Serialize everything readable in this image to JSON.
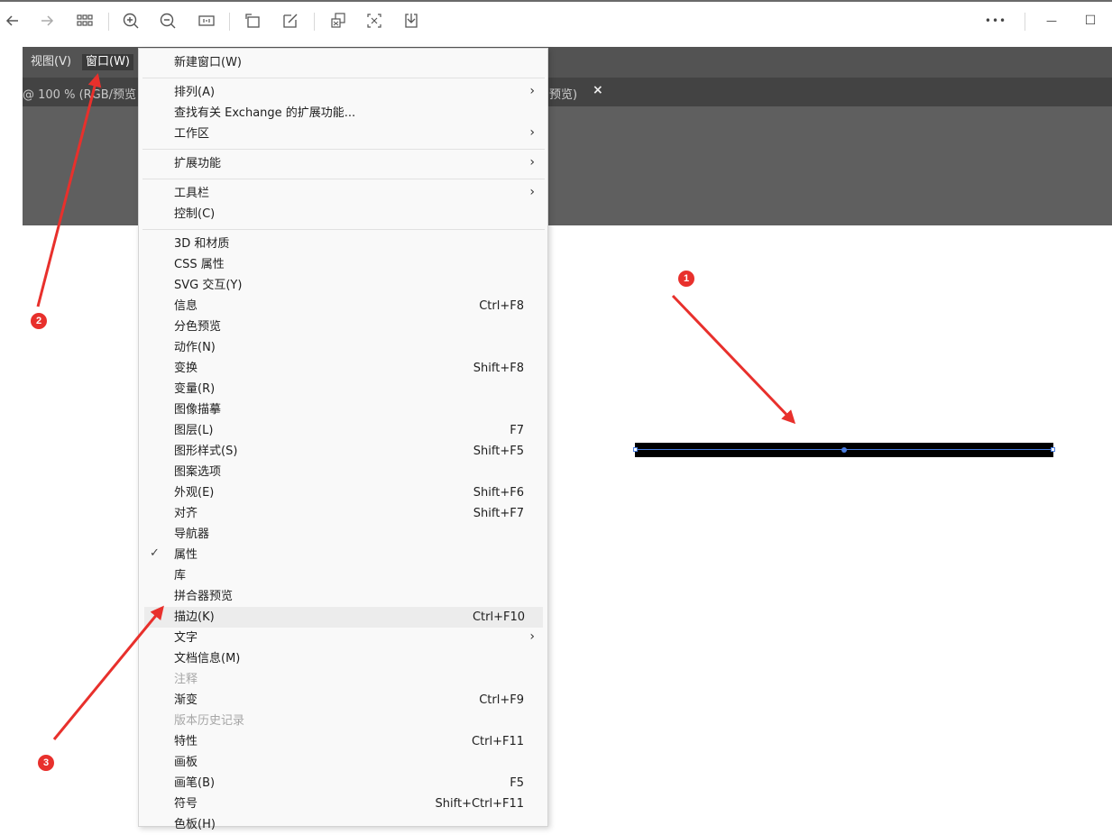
{
  "viewer_toolbar": {
    "icons": [
      "back-arrow-icon",
      "forward-arrow-icon",
      "grid-icon",
      "zoom-in-icon",
      "zoom-out-icon",
      "fit-page-icon",
      "rotate-icon",
      "edit-icon",
      "extract-text-icon",
      "ocr-icon",
      "download-icon",
      "more-icon",
      "minimize-icon",
      "maximize-icon"
    ],
    "more_label": "•••",
    "minimize_label": "—",
    "maximize_label": "☐"
  },
  "app_menubar": {
    "view_label": "视图(V)",
    "window_label": "窗口(W)"
  },
  "doc_tabs": {
    "left_text": "@ 100 % (RGB/预览",
    "right_text": "预览)",
    "close_label": "×"
  },
  "window_menu": {
    "items": [
      {
        "label": "新建窗口(W)",
        "shortcut": "",
        "arrow": false,
        "checked": false,
        "disabled": false
      },
      {
        "label": "排列(A)",
        "shortcut": "",
        "arrow": true,
        "checked": false,
        "disabled": false
      },
      {
        "label": "查找有关 Exchange 的扩展功能...",
        "shortcut": "",
        "arrow": false,
        "checked": false,
        "disabled": false
      },
      {
        "label": "工作区",
        "shortcut": "",
        "arrow": true,
        "checked": false,
        "disabled": false
      },
      {
        "label": "扩展功能",
        "shortcut": "",
        "arrow": true,
        "checked": false,
        "disabled": false
      },
      {
        "label": "工具栏",
        "shortcut": "",
        "arrow": true,
        "checked": false,
        "disabled": false
      },
      {
        "label": "控制(C)",
        "shortcut": "",
        "arrow": false,
        "checked": false,
        "disabled": false
      },
      {
        "label": "3D 和材质",
        "shortcut": "",
        "arrow": false,
        "checked": false,
        "disabled": false
      },
      {
        "label": "CSS 属性",
        "shortcut": "",
        "arrow": false,
        "checked": false,
        "disabled": false
      },
      {
        "label": "SVG 交互(Y)",
        "shortcut": "",
        "arrow": false,
        "checked": false,
        "disabled": false
      },
      {
        "label": "信息",
        "shortcut": "Ctrl+F8",
        "arrow": false,
        "checked": false,
        "disabled": false
      },
      {
        "label": "分色预览",
        "shortcut": "",
        "arrow": false,
        "checked": false,
        "disabled": false
      },
      {
        "label": "动作(N)",
        "shortcut": "",
        "arrow": false,
        "checked": false,
        "disabled": false
      },
      {
        "label": "变换",
        "shortcut": "Shift+F8",
        "arrow": false,
        "checked": false,
        "disabled": false
      },
      {
        "label": "变量(R)",
        "shortcut": "",
        "arrow": false,
        "checked": false,
        "disabled": false
      },
      {
        "label": "图像描摹",
        "shortcut": "",
        "arrow": false,
        "checked": false,
        "disabled": false
      },
      {
        "label": "图层(L)",
        "shortcut": "F7",
        "arrow": false,
        "checked": false,
        "disabled": false
      },
      {
        "label": "图形样式(S)",
        "shortcut": "Shift+F5",
        "arrow": false,
        "checked": false,
        "disabled": false
      },
      {
        "label": "图案选项",
        "shortcut": "",
        "arrow": false,
        "checked": false,
        "disabled": false
      },
      {
        "label": "外观(E)",
        "shortcut": "Shift+F6",
        "arrow": false,
        "checked": false,
        "disabled": false
      },
      {
        "label": "对齐",
        "shortcut": "Shift+F7",
        "arrow": false,
        "checked": false,
        "disabled": false
      },
      {
        "label": "导航器",
        "shortcut": "",
        "arrow": false,
        "checked": false,
        "disabled": false
      },
      {
        "label": "属性",
        "shortcut": "",
        "arrow": false,
        "checked": true,
        "disabled": false
      },
      {
        "label": "库",
        "shortcut": "",
        "arrow": false,
        "checked": false,
        "disabled": false
      },
      {
        "label": "拼合器预览",
        "shortcut": "",
        "arrow": false,
        "checked": false,
        "disabled": false
      },
      {
        "label": "描边(K)",
        "shortcut": "Ctrl+F10",
        "arrow": false,
        "checked": false,
        "disabled": false,
        "highlight": true
      },
      {
        "label": "文字",
        "shortcut": "",
        "arrow": true,
        "checked": false,
        "disabled": false
      },
      {
        "label": "文档信息(M)",
        "shortcut": "",
        "arrow": false,
        "checked": false,
        "disabled": false
      },
      {
        "label": "注释",
        "shortcut": "",
        "arrow": false,
        "checked": false,
        "disabled": true
      },
      {
        "label": "渐变",
        "shortcut": "Ctrl+F9",
        "arrow": false,
        "checked": false,
        "disabled": false
      },
      {
        "label": "版本历史记录",
        "shortcut": "",
        "arrow": false,
        "checked": false,
        "disabled": true
      },
      {
        "label": "特性",
        "shortcut": "Ctrl+F11",
        "arrow": false,
        "checked": false,
        "disabled": false
      },
      {
        "label": "画板",
        "shortcut": "",
        "arrow": false,
        "checked": false,
        "disabled": false
      },
      {
        "label": "画笔(B)",
        "shortcut": "F5",
        "arrow": false,
        "checked": false,
        "disabled": false
      },
      {
        "label": "符号",
        "shortcut": "Shift+Ctrl+F11",
        "arrow": false,
        "checked": false,
        "disabled": false
      },
      {
        "label": "色板(H)",
        "shortcut": "",
        "arrow": false,
        "checked": false,
        "disabled": false
      }
    ],
    "check_glyph": "✓",
    "arrow_glyph": "›"
  },
  "annotations": {
    "badge_1": "1",
    "badge_2": "2",
    "badge_3": "3",
    "color": "#e8302c"
  },
  "colors": {
    "menubar": "#535353",
    "tabbar": "#434343",
    "panel": "#5f5f5f",
    "selection": "#4a7de0",
    "annotation": "#e8302c"
  }
}
